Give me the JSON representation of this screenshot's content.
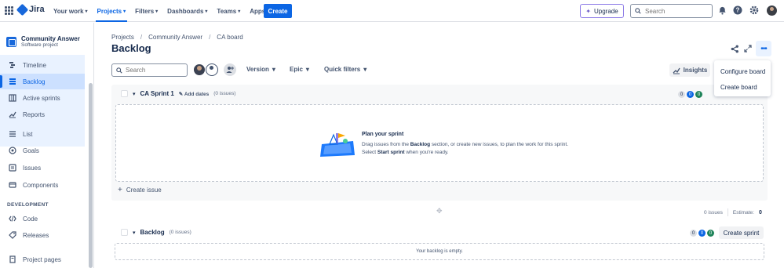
{
  "topbar": {
    "logo_text": "Jira",
    "nav": [
      {
        "label": "Your work"
      },
      {
        "label": "Projects"
      },
      {
        "label": "Filters"
      },
      {
        "label": "Dashboards"
      },
      {
        "label": "Teams"
      },
      {
        "label": "Apps"
      }
    ],
    "create_label": "Create",
    "upgrade_label": "Upgrade",
    "search_placeholder": "Search"
  },
  "sidebar": {
    "project_name": "Community Answer",
    "project_type": "Software project",
    "items": [
      {
        "label": "Timeline",
        "icon": "timeline-icon"
      },
      {
        "label": "Backlog",
        "icon": "backlog-icon"
      },
      {
        "label": "Active sprints",
        "icon": "board-icon"
      },
      {
        "label": "Reports",
        "icon": "reports-icon"
      },
      {
        "label": "List",
        "icon": "list-icon"
      },
      {
        "label": "Goals",
        "icon": "goals-icon"
      },
      {
        "label": "Issues",
        "icon": "issues-icon"
      },
      {
        "label": "Components",
        "icon": "components-icon"
      },
      {
        "label": "Code",
        "icon": "code-icon"
      },
      {
        "label": "Releases",
        "icon": "releases-icon"
      },
      {
        "label": "Project pages",
        "icon": "pages-icon"
      }
    ],
    "section_development": "DEVELOPMENT"
  },
  "breadcrumbs": [
    "Projects",
    "Community Answer",
    "CA board"
  ],
  "page_title": "Backlog",
  "toolbar": {
    "search_placeholder": "Search",
    "version_label": "Version",
    "epic_label": "Epic",
    "quick_filters_label": "Quick filters",
    "insights_label": "Insights"
  },
  "more_menu": {
    "items": [
      "Configure board",
      "Create board"
    ]
  },
  "sprint": {
    "name": "CA Sprint 1",
    "add_dates": "Add dates",
    "issue_count": "(0 issues)",
    "counts": [
      "0",
      "0",
      "0"
    ],
    "empty_title": "Plan your sprint",
    "empty_desc_1": "Drag issues from the ",
    "empty_desc_bold1": "Backlog",
    "empty_desc_2": " section, or create new issues, to plan the work for this sprint. Select ",
    "empty_desc_bold2": "Start sprint",
    "empty_desc_3": " when you're ready.",
    "create_issue": "Create issue",
    "footer_issues": "0 issues",
    "footer_estimate_label": "Estimate:",
    "footer_estimate_value": "0"
  },
  "backlog": {
    "name": "Backlog",
    "issue_count": "(0 issues)",
    "counts": [
      "0",
      "0",
      "0"
    ],
    "create_sprint": "Create sprint",
    "empty_text": "Your backlog is empty."
  },
  "colors": {
    "brand": "#0C66E4",
    "sidebar_active_bg": "#CCE0FF",
    "sidebar_group_bg": "#E9F2FF",
    "done_green": "#1F845A"
  }
}
